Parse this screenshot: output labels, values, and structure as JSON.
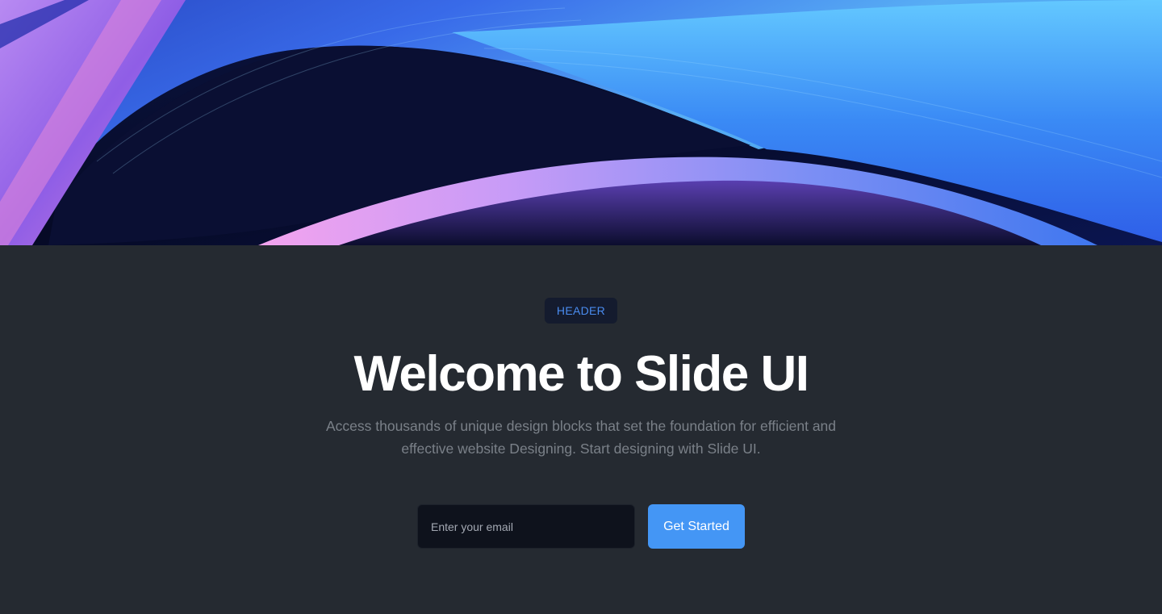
{
  "hero": {
    "image_description": "abstract 3D swirling ribbons in blue, purple and pink",
    "colors": {
      "background": "#070b22",
      "blue_light": "#5fc0ff",
      "blue": "#3d73f0",
      "violet": "#8b5cf6",
      "pink": "#e28ce6"
    }
  },
  "header": {
    "badge": "HEADER",
    "title": "Welcome to Slide UI",
    "subtitle": "Access thousands of unique design blocks that set the foundation for efficient and effective website Designing. Start designing with Slide UI."
  },
  "signup": {
    "email_placeholder": "Enter your email",
    "email_value": "",
    "button_label": "Get Started"
  },
  "theme": {
    "background": "#252a31",
    "accent": "#4496f5",
    "badge_text": "#4a8cf0"
  }
}
